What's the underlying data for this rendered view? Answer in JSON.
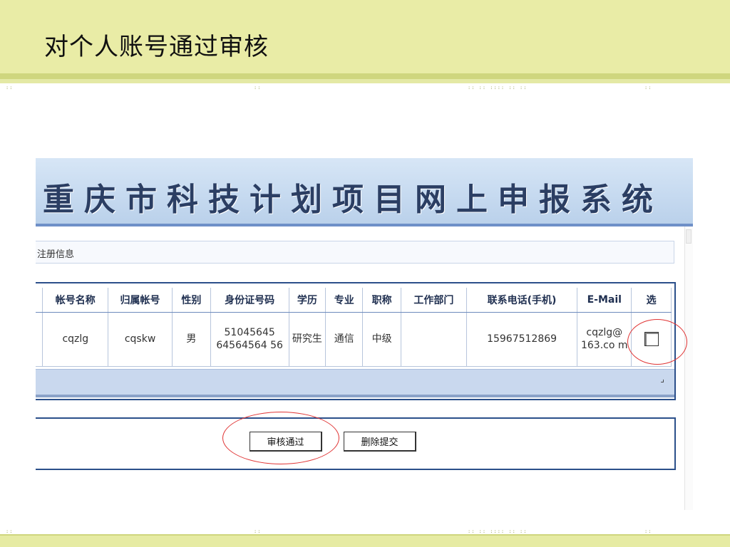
{
  "slide": {
    "title": "对个人账号通过审核"
  },
  "app": {
    "banner_title": "重庆市科技计划项目网上申报系统"
  },
  "section": {
    "label": "注册信息"
  },
  "table": {
    "columns": [
      "帐号名称",
      "归属帐号",
      "性别",
      "身份证号码",
      "学历",
      "专业",
      "职称",
      "工作部门",
      "联系电话(手机)",
      "E-Mail",
      "选"
    ],
    "rows": [
      {
        "account_name": "cqzlg",
        "parent_account": "cqskw",
        "gender": "男",
        "id_number": "51045645 64564564 56",
        "education": "研究生",
        "major": "通信",
        "title": "中级",
        "department": "",
        "phone": "15967512869",
        "email": "cqzlg@ 163.co m",
        "selected": false
      }
    ],
    "footer_mark": "⌟"
  },
  "actions": {
    "approve_label": "审核通过",
    "delete_label": "删除提交"
  },
  "colors": {
    "header_band": "#e9eca6",
    "frame_blue": "#2b4f8a",
    "highlight_oval": "#e03434"
  },
  "icons": {
    "checkbox": "checkbox-icon",
    "scroll_up": "scroll-up-icon"
  }
}
